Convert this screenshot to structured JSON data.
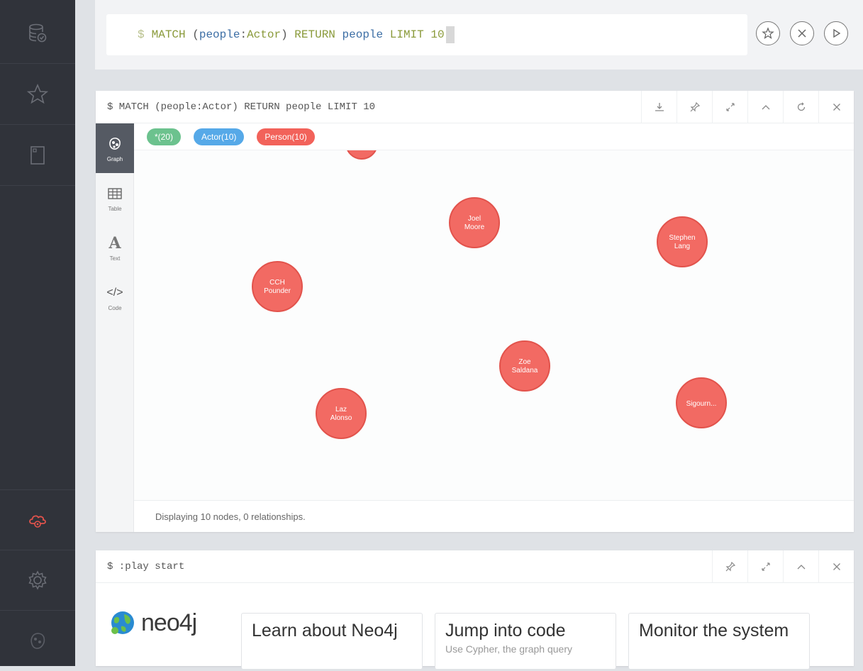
{
  "editor": {
    "prompt": "$",
    "query_parts": {
      "kw_match": "MATCH",
      "open": "(",
      "var": "people",
      "colon": ":",
      "label": "Actor",
      "close": ")",
      "kw_return": "RETURN",
      "ret_var": "people",
      "kw_limit": "LIMIT",
      "limit": "10"
    }
  },
  "frame1": {
    "title": "$ MATCH (people:Actor) RETURN people LIMIT 10",
    "view_tabs": [
      {
        "label": "Graph",
        "active": true
      },
      {
        "label": "Table",
        "active": false
      },
      {
        "label": "Text",
        "active": false
      },
      {
        "label": "Code",
        "active": false
      }
    ],
    "text_glyph": "A",
    "code_glyph": "</>",
    "labels": [
      {
        "text": "*(20)",
        "color": "#6cc28e"
      },
      {
        "text": "Actor(10)",
        "color": "#56a9e8"
      },
      {
        "text": "Person(10)",
        "color": "#f2625a"
      }
    ],
    "node_color": "#f26a63",
    "node_border": "#e2534c",
    "nodes": [
      {
        "label": [
          "Joel",
          "Moore"
        ]
      },
      {
        "label": [
          "Stephen",
          "Lang"
        ]
      },
      {
        "label": [
          "CCH",
          "Pounder"
        ]
      },
      {
        "label": [
          "Zoe",
          "Saldana"
        ]
      },
      {
        "label": [
          "Sigourn..."
        ]
      },
      {
        "label": [
          "Laz",
          "Alonso"
        ]
      }
    ],
    "status": "Displaying 10 nodes, 0 relationships."
  },
  "frame2": {
    "title": "$ :play start",
    "logo_text": "neo4j",
    "cards": [
      {
        "title": "Learn about Neo4j",
        "desc": ""
      },
      {
        "title": "Jump into code",
        "desc": "Use Cypher, the graph query"
      },
      {
        "title": "Monitor the system",
        "desc": ""
      }
    ]
  },
  "colors": {
    "sidebar": "#30333a",
    "accent_red": "#e2534c"
  }
}
